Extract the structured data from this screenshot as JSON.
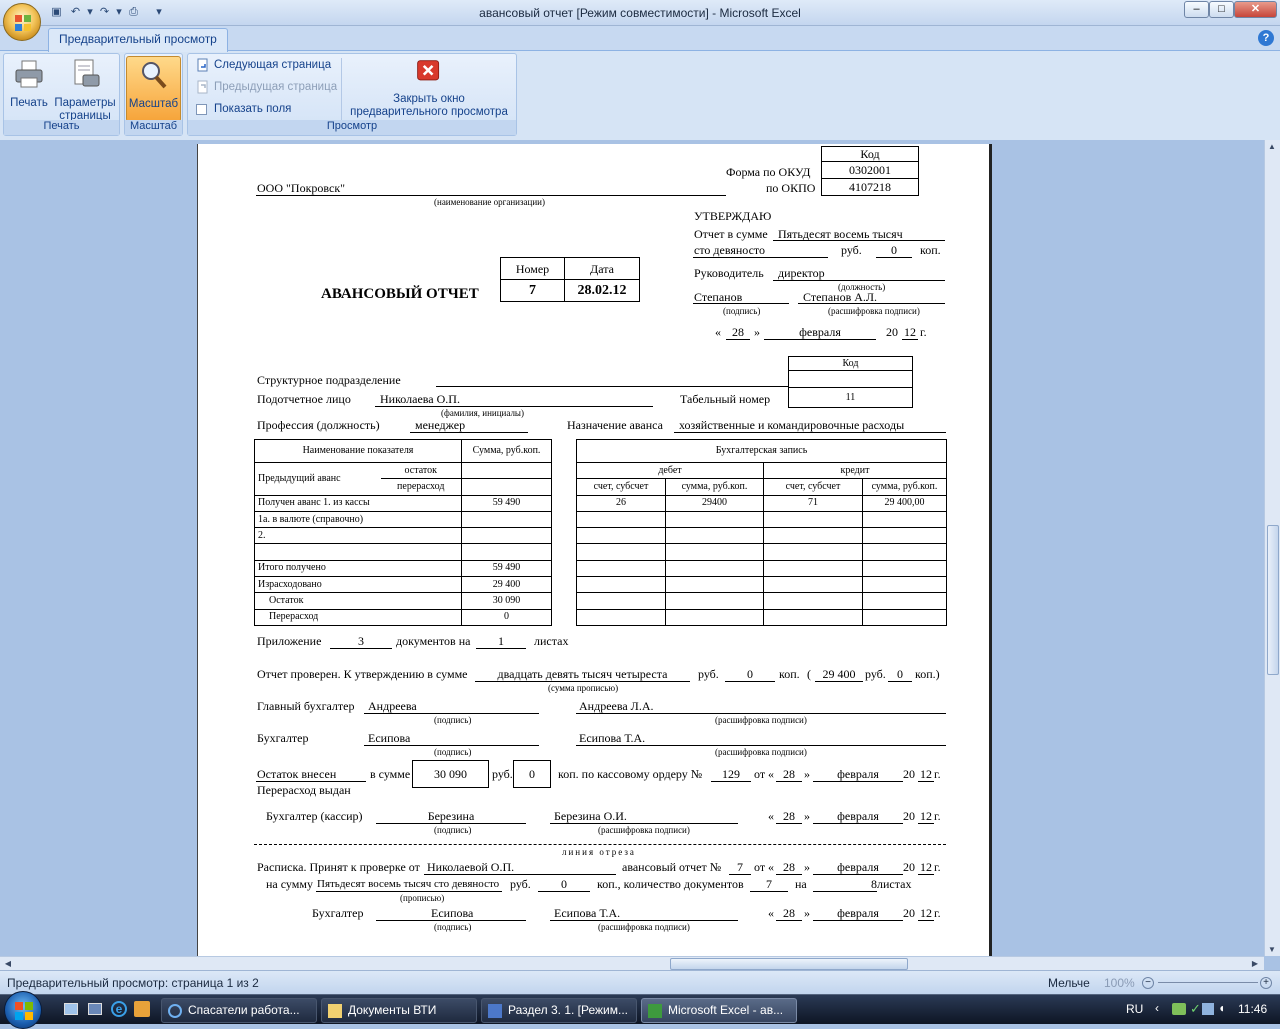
{
  "window": {
    "title": "авансовый отчет  [Режим совместимости] - Microsoft Excel",
    "minimize": "–",
    "maximize": "□",
    "close": "✕"
  },
  "ribbon": {
    "tab": "Предварительный просмотр",
    "help": "?",
    "groups": {
      "print": {
        "label": "Печать",
        "print_btn": "Печать",
        "page_setup_line1": "Параметры",
        "page_setup_line2": "страницы"
      },
      "zoom": {
        "label": "Масштаб",
        "zoom_btn": "Масштаб"
      },
      "preview": {
        "label": "Просмотр",
        "next_page": "Следующая страница",
        "prev_page": "Предыдущая страница",
        "show_margins": "Показать поля",
        "close_line1": "Закрыть окно",
        "close_line2": "предварительного просмотра"
      }
    }
  },
  "doc": {
    "kod": "Код",
    "okud_label": "Форма по ОКУД",
    "okud": "0302001",
    "okpo_label": "по ОКПО",
    "okpo": "4107218",
    "org": "ООО \"Покровск\"",
    "org_hint": "(наименование организации)",
    "utverzhdayu": "УТВЕРЖДАЮ",
    "report_sum_label": "Отчет в сумме",
    "report_sum_words1": "Пятьдесят восемь тысяч",
    "report_sum_words2": "сто девяносто",
    "rub": "руб.",
    "kop": "коп.",
    "rub_cents_approve": "0",
    "head_label": "Руководитель",
    "head_position": "директор",
    "position_hint": "(должность)",
    "head_sign": "Степанов",
    "head_name": "Степанов А.Л.",
    "sign_hint": "(подпись)",
    "decode_hint": "(расшифровка подписи)",
    "quote_open": "«",
    "quote_close": "»",
    "approve_day": "28",
    "approve_month": "февраля",
    "yr_prefix": "20",
    "approve_year": "12",
    "g": "г.",
    "title": "АВАНСОВЫЙ ОТЧЕТ",
    "num_label": "Номер",
    "date_label": "Дата",
    "number": "7",
    "date": "28.02.12",
    "kod2": "Код",
    "dept_label": "Структурное подразделение",
    "person_label": "Подотчетное лицо",
    "person": "Николаева О.П.",
    "person_hint": "(фамилия, инициалы)",
    "tab_num_label": "Табельный номер",
    "tab_num": "11",
    "profession_label": "Профессия (должность)",
    "profession": "менеджер",
    "purpose_label": "Назначение аванса",
    "purpose": "хозяйственные и командировочные расходы",
    "left_table": {
      "h_name": "Наименование показателя",
      "h_sum": "Сумма, руб.коп.",
      "prev_advance": "Предыдущий аванс",
      "ostatok": "остаток",
      "pererashod": "перерасход",
      "rows": [
        {
          "name": "Получен аванс 1. из кассы",
          "sum": "59 490"
        },
        {
          "name": "1а. в валюте (справочно)",
          "sum": ""
        },
        {
          "name": "2.",
          "sum": ""
        },
        {
          "name": "",
          "sum": ""
        },
        {
          "name": "Итого получено",
          "sum": "59 490"
        },
        {
          "name": "Израсходовано",
          "sum": "29 400"
        },
        {
          "name": "Остаток",
          "sum": "30 090"
        },
        {
          "name": "Перерасход",
          "sum": "0"
        }
      ]
    },
    "right_table": {
      "h_title": "Бухгалтерская запись",
      "debit": "дебет",
      "credit": "кредит",
      "h_acc": "счет, субсчет",
      "h_sum": "сумма, руб.коп.",
      "rows": [
        [
          "26",
          "29400",
          "71",
          "29 400,00"
        ],
        [
          "",
          "",
          "",
          ""
        ],
        [
          "",
          "",
          "",
          ""
        ],
        [
          "",
          "",
          "",
          ""
        ],
        [
          "",
          "",
          "",
          ""
        ],
        [
          "",
          "",
          "",
          ""
        ],
        [
          "",
          "",
          "",
          ""
        ],
        [
          "",
          "",
          "",
          ""
        ]
      ]
    },
    "appendix_label": "Приложение",
    "appendix_docs": "3",
    "docs_on": "документов на",
    "appendix_sheets": "1",
    "sheets": "листах",
    "checked_label": "Отчет проверен. К утверждению в сумме",
    "checked_words": "двадцать девять тысяч четыреста",
    "sum_words_hint": "(сумма прописью)",
    "checked_kop": "0",
    "paren_open": "(",
    "paren_close": "коп.)",
    "checked_num": "29 400",
    "checked_num_kop": "0",
    "chief_acc_label": "Главный бухгалтер",
    "chief_acc_sign": "Андреева",
    "chief_acc_name": "Андреева Л.А.",
    "acc_label": "Бухгалтер",
    "acc_sign": "Есипова",
    "acc_name": "Есипова Т.А.",
    "remainder_label": "Остаток внесен",
    "overspend_label": "Перерасход выдан",
    "in_sum": "в сумме",
    "remainder_sum": "30 090",
    "remainder_kop": "0",
    "cash_order": "коп. по кассовому ордеру №",
    "order_num": "129",
    "ot": "от",
    "order_day": "28",
    "order_month": "февраля",
    "order_year": "12",
    "cashier_label": "Бухгалтер (кассир)",
    "cashier_sign": "Березина",
    "cashier_name": "Березина О.И.",
    "cashier_day": "28",
    "cashier_month": "февраля",
    "cashier_year": "12",
    "cut_line": "линия отреза",
    "receipt_label": "Расписка. Принят к проверке от",
    "receipt_from": "Николаевой О.П.",
    "advance_report_no": "авансовый отчет №",
    "receipt_no": "7",
    "receipt_day": "28",
    "receipt_month": "февраля",
    "receipt_year": "12",
    "to_sum": "на сумму",
    "receipt_words": "Пятьдесят восемь тысяч сто девяносто",
    "words_hint": "(прописью)",
    "receipt_rub": "0",
    "docs_count_label": "коп., количество документов",
    "docs_count": "7",
    "na": "на",
    "receipt_sheets": "8",
    "sheets2": "листах",
    "r_acc_label": "Бухгалтер",
    "r_acc_sign": "Есипова",
    "r_acc_name": "Есипова Т.А.",
    "r_day": "28",
    "r_month": "февраля",
    "r_year": "12"
  },
  "statusbar": {
    "text": "Предварительный просмотр: страница 1 из 2",
    "zoom_out": "Мельче",
    "zoom_level": "100%"
  },
  "taskbar": {
    "items": [
      "Спасатели работа...",
      "Документы ВТИ",
      "Раздел 3. 1. [Режим...",
      "Microsoft Excel - ав..."
    ],
    "lang": "RU",
    "clock": "11:46"
  }
}
